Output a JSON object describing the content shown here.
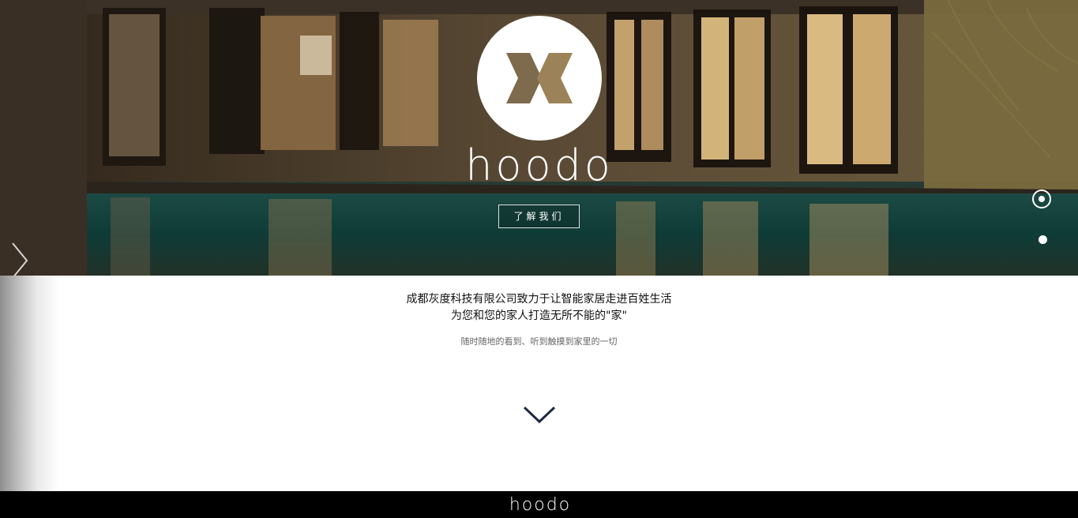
{
  "hero": {
    "brand": "hoodo",
    "about_button": "了解我们",
    "icons": [
      "hoodo-logo-mark",
      "arrow-left-icon"
    ],
    "slides_count": 2,
    "active_slide": 1
  },
  "intro": {
    "line1": "成都灰度科技有限公司致力于让智能家居走进百姓生活",
    "line2": "为您和您的家人打造无所不能的\"家\"",
    "subtitle": "随时随地的看到、听到触摸到家里的一切"
  },
  "scroll_icon": "chevron-down-icon",
  "footer": {
    "brand": "hoodo"
  },
  "colors": {
    "chevron": "#1f2a44",
    "logo_gold": "#8b7350",
    "footer_bg": "#000000"
  }
}
